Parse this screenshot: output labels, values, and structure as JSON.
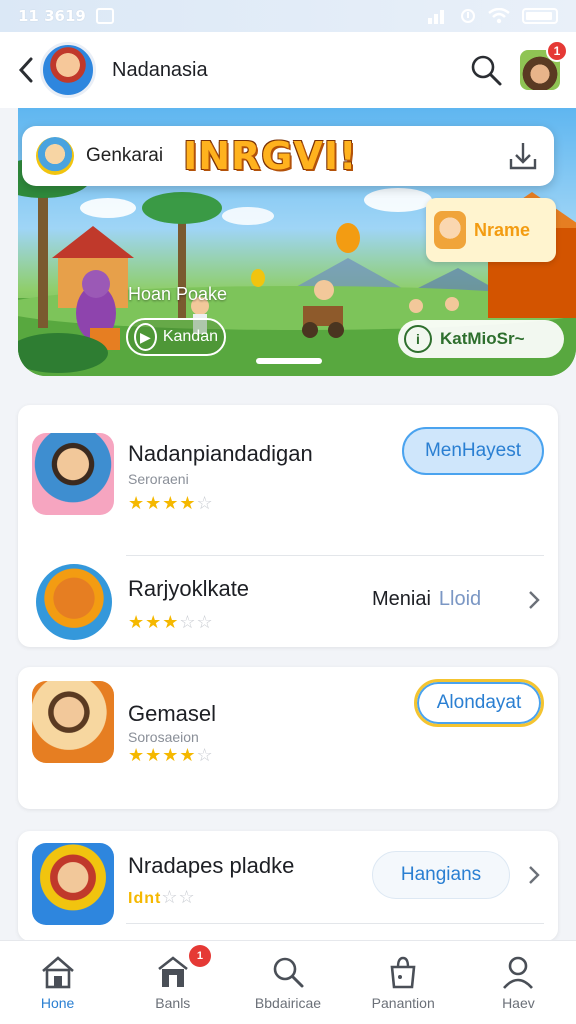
{
  "status_bar": {
    "time": "11 3619",
    "wifi": true,
    "battery": "full"
  },
  "header": {
    "title": "Nadanasia",
    "back_icon": "chevron-left-icon",
    "search_icon": "search-icon",
    "notification_count": "1"
  },
  "banner": {
    "search_text": "Genkarai",
    "logo_text": "INRGVI!",
    "game_card_label": "Nrame",
    "scene_caption": "Hoan Poake",
    "pill_left_label": "Kandan",
    "pill_right_label": "KatMioSr~",
    "download_icon": "download-icon"
  },
  "list": {
    "items": [
      {
        "name": "Nadanpiandadigan",
        "subtitle": "Seroraeni",
        "rating": 4,
        "action_type": "button",
        "action_label": "MenHayest"
      },
      {
        "name": "Rarjyoklkate",
        "subtitle": "",
        "rating": 2.5,
        "action_type": "link",
        "action_label": "Meniai",
        "action_label_secondary": "Lloid"
      },
      {
        "name": "Gemasel",
        "subtitle": "Sorosaeion",
        "rating": 4,
        "action_type": "button",
        "action_label": "Alondayat"
      },
      {
        "name": "Nradapes pladke",
        "subtitle": "",
        "rating_label": "Idnt",
        "rating": 2,
        "action_type": "button",
        "action_label": "Hangians"
      }
    ]
  },
  "bottom_nav": {
    "items": [
      {
        "label": "Hone",
        "icon": "home-icon",
        "active": true
      },
      {
        "label": "Banls",
        "icon": "store-icon",
        "active": false,
        "badge": "1"
      },
      {
        "label": "Bbdairicae",
        "icon": "search-icon",
        "active": false
      },
      {
        "label": "Panantion",
        "icon": "bag-icon",
        "active": false
      },
      {
        "label": "Haev",
        "icon": "user-icon",
        "active": false
      }
    ]
  },
  "colors": {
    "accent": "#2a7fd2",
    "star": "#f5b800",
    "badge": "#e53935",
    "logo": "#ffb21e"
  }
}
